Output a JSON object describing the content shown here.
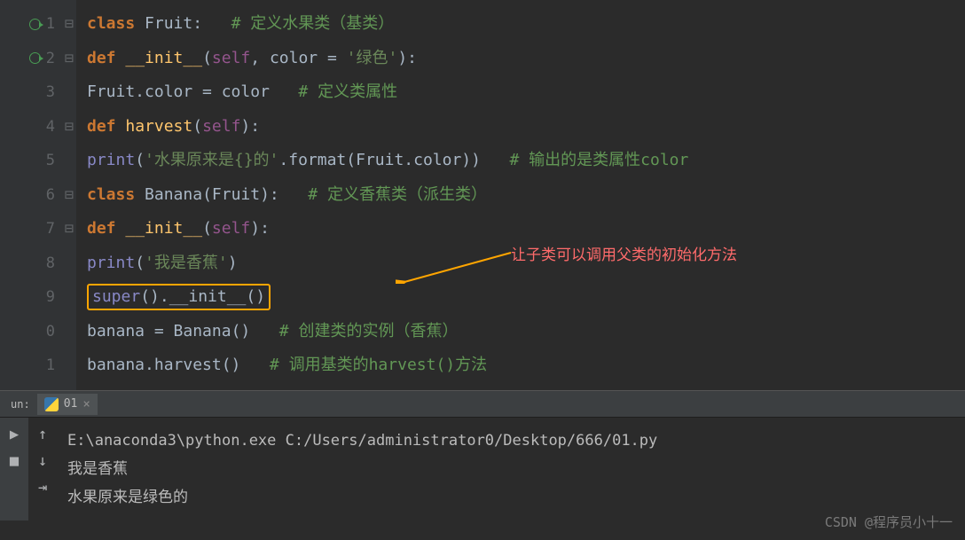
{
  "gutter": {
    "lines": [
      "1",
      "2",
      "3",
      "4",
      "5",
      "6",
      "7",
      "8",
      "9",
      "0",
      "1"
    ]
  },
  "code": {
    "l1": {
      "kw1": "class ",
      "cls": "Fruit",
      "p": ":",
      "c": "   # 定义水果类（基类）"
    },
    "l2": {
      "kw1": "def ",
      "fn": "__init__",
      "p1": "(",
      "self": "self",
      "p2": ", color = ",
      "str": "'绿色'",
      "p3": "):"
    },
    "l3": {
      "pre": "Fruit.color = color",
      "c": "   # 定义类属性"
    },
    "l4": {
      "kw1": "def ",
      "fn": "harvest",
      "p1": "(",
      "self": "self",
      "p2": "):"
    },
    "l5": {
      "fn": "print",
      "p1": "(",
      "str": "'水果原来是{}的'",
      "p2": ".",
      "m": "format",
      "p3": "(Fruit.color))",
      "c": "   # 输出的是类属性color"
    },
    "l6": {
      "kw1": "class ",
      "cls": "Banana",
      "p1": "(Fruit):",
      "c": "   # 定义香蕉类（派生类）"
    },
    "l7": {
      "kw1": "def ",
      "fn": "__init__",
      "p1": "(",
      "self": "self",
      "p2": "):"
    },
    "l8": {
      "fn": "print",
      "p1": "(",
      "str": "'我是香蕉'",
      "p2": ")"
    },
    "l9": {
      "fn": "super",
      "p1": "().",
      "m": "__init__",
      "p2": "()"
    },
    "l10": {
      "v": "banana = ",
      "fn": "Banana",
      "p": "()",
      "c": "   # 创建类的实例（香蕉）"
    },
    "l11": {
      "v": "banana.",
      "fn": "harvest",
      "p": "()",
      "c": "   # 调用基类的harvest()方法"
    }
  },
  "annotation": "让子类可以调用父类的初始化方法",
  "run": {
    "label": "un:",
    "tab": "01"
  },
  "output": {
    "line1": "E:\\anaconda3\\python.exe C:/Users/administrator0/Desktop/666/01.py",
    "line2": "我是香蕉",
    "line3": "水果原来是绿色的"
  },
  "watermark": "CSDN @程序员小十一"
}
